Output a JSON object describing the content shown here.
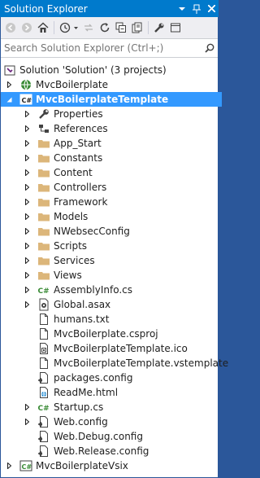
{
  "window": {
    "title": "Solution Explorer"
  },
  "search": {
    "placeholder": "Search Solution Explorer (Ctrl+;)"
  },
  "toolbar": {
    "buttons": [
      "back-icon",
      "forward-icon",
      "home-icon",
      "history-icon",
      "pending-changes-icon",
      "refresh-icon",
      "collapse-all-icon",
      "show-all-files-icon",
      "properties-icon",
      "preview-icon"
    ]
  },
  "tree": {
    "solution": "Solution 'Solution' (3 projects)",
    "project1": "MvcBoilerplate",
    "project2": "MvcBoilerplateTemplate",
    "project3": "MvcBoilerplateVsix",
    "items": [
      "Properties",
      "References",
      "App_Start",
      "Constants",
      "Content",
      "Controllers",
      "Framework",
      "Models",
      "NWebsecConfig",
      "Scripts",
      "Services",
      "Views",
      "AssemblyInfo.cs",
      "Global.asax",
      "humans.txt",
      "MvcBoilerplate.csproj",
      "MvcBoilerplateTemplate.ico",
      "MvcBoilerplateTemplate.vstemplate",
      "packages.config",
      "ReadMe.html",
      "Startup.cs",
      "Web.config",
      "Web.Debug.config",
      "Web.Release.config"
    ]
  },
  "colors": {
    "accent": "#007acc",
    "selection": "#3399ff",
    "folder": "#dcb67a",
    "csharp": "#388a34"
  }
}
